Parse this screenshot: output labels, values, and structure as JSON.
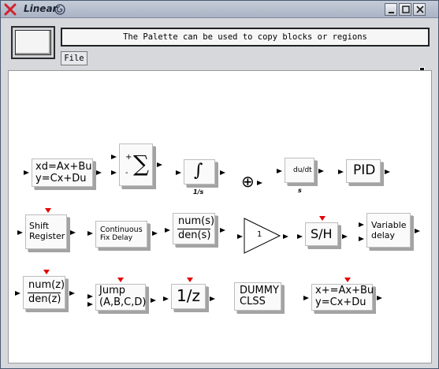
{
  "window": {
    "title": "Linear"
  },
  "header": {
    "info_text": "The Palette can be used to copy blocks or regions",
    "file_menu": "File"
  },
  "blocks": {
    "state_space_line1": "xd=Ax+Bu",
    "state_space_line2": "y=Cx+Du",
    "sum_plus": "+",
    "sum_minus": "-",
    "sum_symbol": "∑",
    "integral_symbol": "∫",
    "integral_label": "1/s",
    "sum_circle": "⊕",
    "derivative_text": "du/dt",
    "derivative_label": "s",
    "pid": "PID",
    "shift_register_line1": "Shift",
    "shift_register_line2": "Register",
    "fix_delay_line1": "Continuous",
    "fix_delay_line2": "Fix Delay",
    "tf_num": "num(s)",
    "tf_den": "den(s)",
    "gain_value": "1",
    "sample_hold": "S/H",
    "var_delay_line1": "Variable",
    "var_delay_line2": "delay",
    "dtf_num": "num(z)",
    "dtf_den": "den(z)",
    "jump_line1": "Jump",
    "jump_line2": "(A,B,C,D)",
    "unit_delay": "1/z",
    "dummy_line1": "DUMMY",
    "dummy_line2": "CLSS",
    "dss_line1": "x+=Ax+Bu",
    "dss_line2": "y=Cx+Du"
  },
  "colors": {
    "trigger": "#e20000",
    "canvas": "#ffffff",
    "chrome": "#d6d8dc"
  }
}
